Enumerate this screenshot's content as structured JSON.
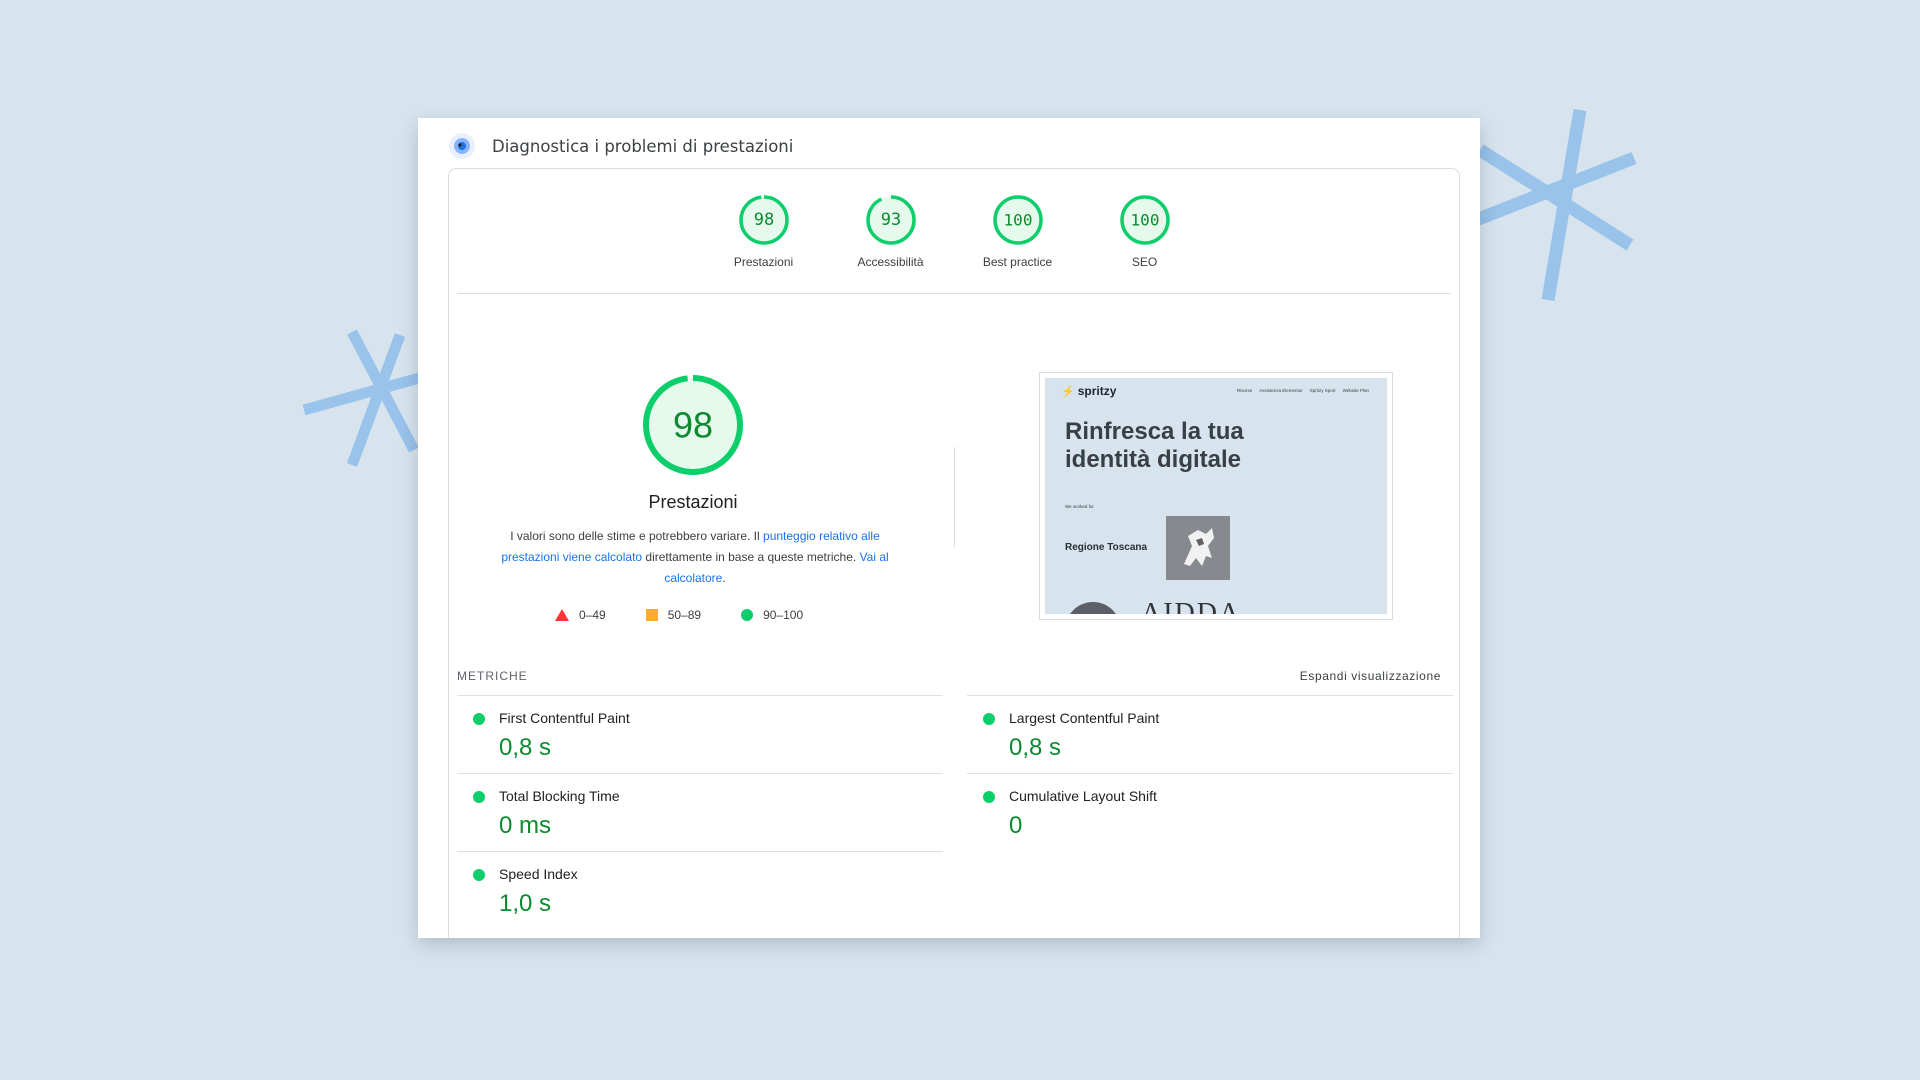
{
  "header": {
    "title": "Diagnostica i problemi di prestazioni"
  },
  "categories": [
    {
      "score": "98",
      "label": "Prestazioni",
      "fraction": 0.98
    },
    {
      "score": "93",
      "label": "Accessibilità",
      "fraction": 0.93
    },
    {
      "score": "100",
      "label": "Best practice",
      "fraction": 1.0
    },
    {
      "score": "100",
      "label": "SEO",
      "fraction": 1.0
    }
  ],
  "main_score": {
    "score": "98",
    "label": "Prestazioni",
    "fraction": 0.98
  },
  "description": {
    "part1": "I valori sono delle stime e potrebbero variare. Il ",
    "link1": "punteggio relativo alle prestazioni viene calcolato",
    "part2": " direttamente in base a queste metriche. ",
    "link2": "Vai al calcolatore",
    "part3": "."
  },
  "legend": [
    {
      "range": "0–49",
      "shape": "triangle",
      "color": "#ff3333"
    },
    {
      "range": "50–89",
      "shape": "square",
      "color": "#ffaa33"
    },
    {
      "range": "90–100",
      "shape": "circle",
      "color": "#0cce6b"
    }
  ],
  "screenshot": {
    "brand": "spritzy",
    "nav": [
      "Risorse",
      "Assistenza Elementor",
      "Spritzy Sport",
      "Website Plan"
    ],
    "headline_line1": "Rinfresca la tua",
    "headline_line2": "identità digitale",
    "small_text": "We worked for",
    "region": "Regione Toscana",
    "aidda": "AIDDA"
  },
  "metrics": {
    "title": "METRICHE",
    "expand_label": "Espandi visualizzazione",
    "left": [
      {
        "name": "First Contentful Paint",
        "value": "0,8 s"
      },
      {
        "name": "Total Blocking Time",
        "value": "0 ms"
      },
      {
        "name": "Speed Index",
        "value": "1,0 s"
      }
    ],
    "right": [
      {
        "name": "Largest Contentful Paint",
        "value": "0,8 s"
      },
      {
        "name": "Cumulative Layout Shift",
        "value": "0"
      }
    ]
  },
  "colors": {
    "pass_green": "#0cce6b",
    "score_text_green": "#0d8a2f",
    "link_blue": "#1a73e8",
    "background": "#d7e4ee",
    "decor_blue": "#99c3eb"
  }
}
